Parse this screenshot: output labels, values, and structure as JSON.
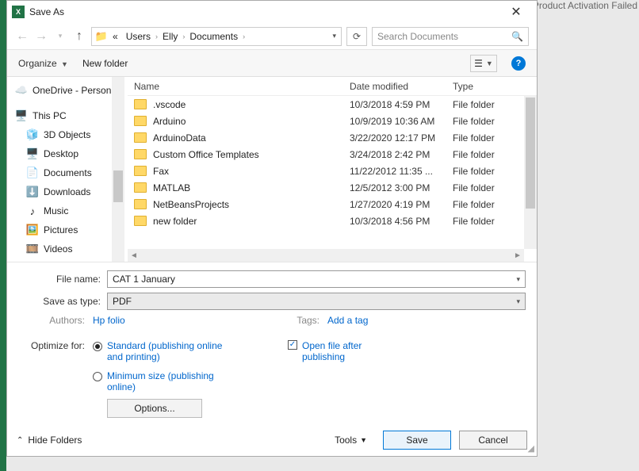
{
  "behind": "Product Activation Failed",
  "title": "Save As",
  "breadcrumb": {
    "prefix": "«",
    "segs": [
      "Users",
      "Elly",
      "Documents"
    ]
  },
  "search": {
    "placeholder": "Search Documents"
  },
  "toolbar": {
    "organize": "Organize",
    "newfolder": "New folder"
  },
  "tree": [
    {
      "icon": "cloud",
      "label": "OneDrive - Person",
      "sub": false
    },
    {
      "icon": "pc",
      "label": "This PC",
      "sub": false
    },
    {
      "icon": "obj3d",
      "label": "3D Objects",
      "sub": true
    },
    {
      "icon": "desk",
      "label": "Desktop",
      "sub": true
    },
    {
      "icon": "doc",
      "label": "Documents",
      "sub": true
    },
    {
      "icon": "down",
      "label": "Downloads",
      "sub": true
    },
    {
      "icon": "music",
      "label": "Music",
      "sub": true
    },
    {
      "icon": "pic",
      "label": "Pictures",
      "sub": true
    },
    {
      "icon": "vid",
      "label": "Videos",
      "sub": true
    }
  ],
  "columns": {
    "name": "Name",
    "date": "Date modified",
    "type": "Type"
  },
  "rows": [
    {
      "name": ".vscode",
      "date": "10/3/2018 4:59 PM",
      "type": "File folder"
    },
    {
      "name": "Arduino",
      "date": "10/9/2019 10:36 AM",
      "type": "File folder"
    },
    {
      "name": "ArduinoData",
      "date": "3/22/2020 12:17 PM",
      "type": "File folder"
    },
    {
      "name": "Custom Office Templates",
      "date": "3/24/2018 2:42 PM",
      "type": "File folder"
    },
    {
      "name": "Fax",
      "date": "11/22/2012 11:35 ...",
      "type": "File folder"
    },
    {
      "name": "MATLAB",
      "date": "12/5/2012 3:00 PM",
      "type": "File folder"
    },
    {
      "name": "NetBeansProjects",
      "date": "1/27/2020 4:19 PM",
      "type": "File folder"
    },
    {
      "name": "new folder",
      "date": "10/3/2018 4:56 PM",
      "type": "File folder"
    }
  ],
  "filename": {
    "label": "File name:",
    "value": "CAT 1 January"
  },
  "savetype": {
    "label": "Save as type:",
    "value": "PDF"
  },
  "authors": {
    "label": "Authors:",
    "value": "Hp folio"
  },
  "tags": {
    "label": "Tags:",
    "value": "Add a tag"
  },
  "optimize": {
    "label": "Optimize for:",
    "opt1": "Standard (publishing online and printing)",
    "opt2": "Minimum size (publishing online)"
  },
  "openafter": "Open file after publishing",
  "optionsbtn": "Options...",
  "footer": {
    "hide": "Hide Folders",
    "tools": "Tools",
    "save": "Save",
    "cancel": "Cancel"
  }
}
